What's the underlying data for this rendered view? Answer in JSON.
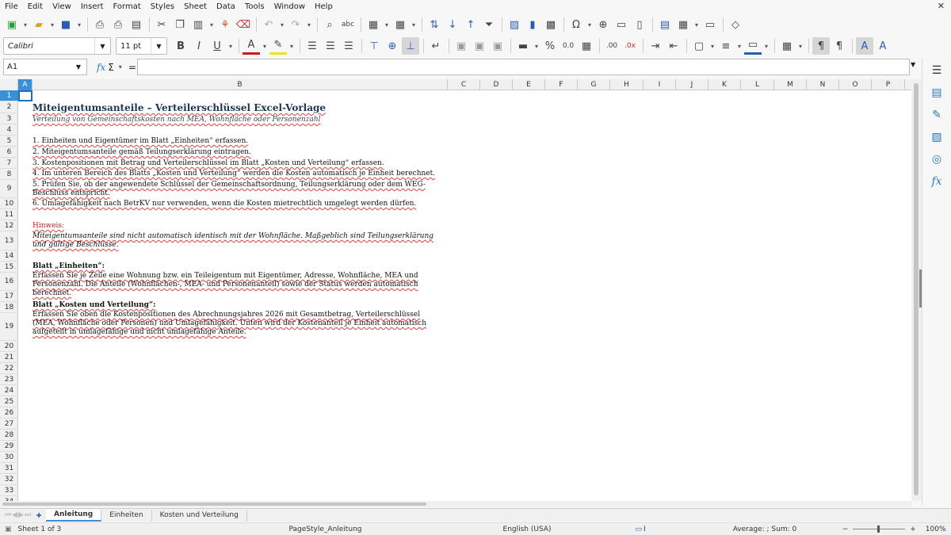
{
  "menu": [
    "File",
    "Edit",
    "View",
    "Insert",
    "Format",
    "Styles",
    "Sheet",
    "Data",
    "Tools",
    "Window",
    "Help"
  ],
  "font": {
    "name": "Calibri",
    "size": "11 pt"
  },
  "name_box": "A1",
  "formula_symbols": {
    "fx": "fx",
    "sum": "Σ",
    "eq": "="
  },
  "columns": [
    "A",
    "B",
    "C",
    "D",
    "E",
    "F",
    "G",
    "H",
    "I",
    "J",
    "K",
    "L",
    "M",
    "N",
    "O",
    "P"
  ],
  "rows": [
    "1",
    "2",
    "3",
    "4",
    "5",
    "6",
    "7",
    "8",
    "9",
    "10",
    "11",
    "12",
    "13",
    "14",
    "15",
    "16",
    "17",
    "18",
    "19",
    "20",
    "21",
    "22",
    "23",
    "24",
    "25",
    "26",
    "27",
    "28",
    "29",
    "30",
    "31",
    "32",
    "33",
    "34"
  ],
  "content": {
    "title": "Miteigentumsanteile – Verteilerschlüssel Excel-Vorlage",
    "subtitle": "Verteilung von Gemeinschaftskosten nach MEA, Wohnfläche oder Personenzahl",
    "step1": "1. Einheiten und Eigentümer im Blatt „Einheiten“ erfassen.",
    "step2": "2. Miteigentumsanteile gemäß Teilungserklärung eintragen.",
    "step3": "3. Kostenpositionen mit Betrag und Verteilerschlüssel im Blatt „Kosten und Verteilung“ erfassen.",
    "step4": "4. Im unteren Bereich des Blatts „Kosten und Verteilung“ werden die Kosten automatisch je Einheit berechnet.",
    "step5": "5. Prüfen Sie, ob der angewendete Schlüssel der Gemeinschaftsordnung, Teilungserklärung oder dem WEG-Beschluss entspricht.",
    "step6": "6. Umlagefähigkeit nach BetrKV nur verwenden, wenn die Kosten mietrechtlich umgelegt werden dürfen.",
    "hint_title": "Hinweis:",
    "hint_text": "Miteigentumsanteile sind nicht automatisch identisch mit der Wohnfläche. Maßgeblich sind Teilungserklärung und gültige Beschlüsse.",
    "sec1_title": "Blatt „Einheiten“:",
    "sec1_text": "Erfassen Sie je Zeile eine Wohnung bzw. ein Teileigentum mit Eigentümer, Adresse, Wohnfläche, MEA und Personenzahl. Die Anteile (Wohnflächen-, MEA- und Personenanteil) sowie der Status werden automatisch berechnet.",
    "sec2_title": "Blatt „Kosten und Verteilung“:",
    "sec2_text": "Erfassen Sie oben die Kostenpositionen des Abrechnungsjahres 2026 mit Gesamtbetrag, Verteilerschlüssel (MEA, Wohnfläche oder Personen) und Umlagefähigkeit. Unten wird der Kostenanteil je Einheit automatisch aufgeteilt in umlagefähige und nicht umlagefähige Anteile."
  },
  "tabs": [
    "Anleitung",
    "Einheiten",
    "Kosten und Verteilung"
  ],
  "status": {
    "sheet": "Sheet 1 of 3",
    "page_style": "PageStyle_Anleitung",
    "language": "English (USA)",
    "summary": "Average: ; Sum: 0",
    "zoom": "100%"
  }
}
